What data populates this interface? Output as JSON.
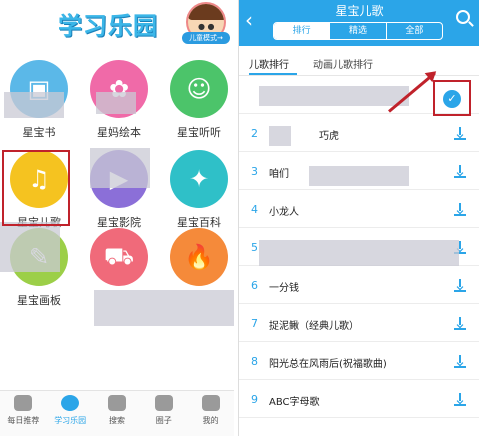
{
  "left": {
    "app_title": "学习乐园",
    "mode_label": "儿童模式→",
    "grid": [
      {
        "label": "星宝书",
        "color": "#5bb8e8",
        "icon": "book-icon",
        "glyph": "▣"
      },
      {
        "label": "星妈绘本",
        "color": "#f06aa8",
        "icon": "picture-book-icon",
        "glyph": "✿"
      },
      {
        "label": "星宝听听",
        "color": "#4cc46a",
        "icon": "headphone-icon",
        "glyph": "☺"
      },
      {
        "label": "星宝儿歌",
        "color": "#f5c320",
        "icon": "music-note-icon",
        "glyph": "♫"
      },
      {
        "label": "星宝影院",
        "color": "#8b6fd8",
        "icon": "cinema-icon",
        "glyph": "▶"
      },
      {
        "label": "星宝百科",
        "color": "#2fc0c8",
        "icon": "encyclopedia-icon",
        "glyph": "✦"
      },
      {
        "label": "星宝画板",
        "color": "#9ccf48",
        "icon": "drawing-board-icon",
        "glyph": "✎"
      },
      {
        "label": "",
        "color": "#f06a7a",
        "icon": "cart-icon",
        "glyph": "⛟"
      },
      {
        "label": "",
        "color": "#f58a3a",
        "icon": "fire-icon",
        "glyph": "🔥"
      }
    ],
    "nav": [
      {
        "label": "每日推荐",
        "icon": "calendar-icon",
        "active": false
      },
      {
        "label": "学习乐园",
        "icon": "smile-icon",
        "active": true
      },
      {
        "label": "搜索",
        "icon": "search-icon",
        "active": false
      },
      {
        "label": "圈子",
        "icon": "circle-icon",
        "active": false
      },
      {
        "label": "我的",
        "icon": "star-icon",
        "active": false
      }
    ]
  },
  "right": {
    "title": "星宝儿歌",
    "segments": [
      "排行",
      "精选",
      "全部"
    ],
    "active_segment": 0,
    "subtabs": [
      "儿歌排行",
      "动画儿歌排行"
    ],
    "rows": [
      {
        "num": "",
        "name": ""
      },
      {
        "num": "2",
        "name": "巧虎"
      },
      {
        "num": "3",
        "name": "咱们"
      },
      {
        "num": "4",
        "name": "小龙人"
      },
      {
        "num": "5",
        "name": ""
      },
      {
        "num": "6",
        "name": "一分钱"
      },
      {
        "num": "7",
        "name": "捉泥鳅（经典儿歌）"
      },
      {
        "num": "8",
        "name": "阳光总在风雨后(祝福歌曲)"
      },
      {
        "num": "9",
        "name": "ABC字母歌"
      }
    ]
  },
  "colors": {
    "accent": "#2ba5e8",
    "highlight": "#c0222b"
  }
}
